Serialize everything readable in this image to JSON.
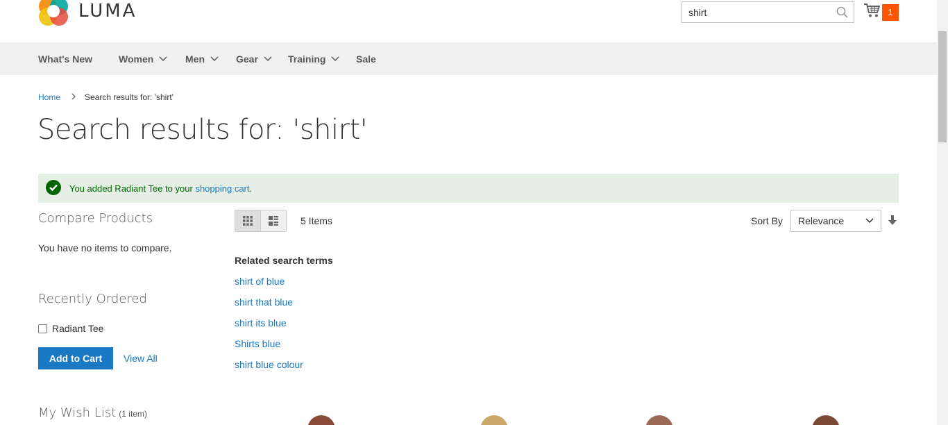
{
  "brand": {
    "name": "LUMA"
  },
  "search": {
    "value": "shirt",
    "placeholder": ""
  },
  "cart": {
    "count": "1"
  },
  "nav": [
    {
      "label": "What's New"
    },
    {
      "label": "Women"
    },
    {
      "label": "Men"
    },
    {
      "label": "Gear"
    },
    {
      "label": "Training"
    },
    {
      "label": "Sale"
    }
  ],
  "breadcrumb": {
    "home": "Home",
    "current": "Search results for: 'shirt'"
  },
  "page_title": "Search results for: 'shirt'",
  "message": {
    "prefix": "You added Radiant Tee to your ",
    "link": "shopping cart",
    "suffix": "."
  },
  "sidebar": {
    "compare_title": "Compare Products",
    "compare_empty": "You have no items to compare.",
    "recent_title": "Recently Ordered",
    "recent_items": [
      {
        "name": "Radiant Tee"
      }
    ],
    "add_to_cart": "Add to Cart",
    "view_all": "View All",
    "wishlist_title": "My Wish List",
    "wishlist_count": "(1 item)"
  },
  "toolbar": {
    "items_count": "5 Items",
    "sort_label": "Sort By",
    "sort_value": "Relevance"
  },
  "related": {
    "title": "Related search terms",
    "terms": [
      "shirt of blue",
      "shirt that blue",
      "shirt its blue",
      "Shirts blue",
      "shirt blue colour"
    ]
  },
  "colors": {
    "link": "#1979c3",
    "accent": "#ff5501",
    "success_bg": "#e5efe5",
    "success_text": "#006400",
    "nav_bg": "#f0f0f0"
  }
}
